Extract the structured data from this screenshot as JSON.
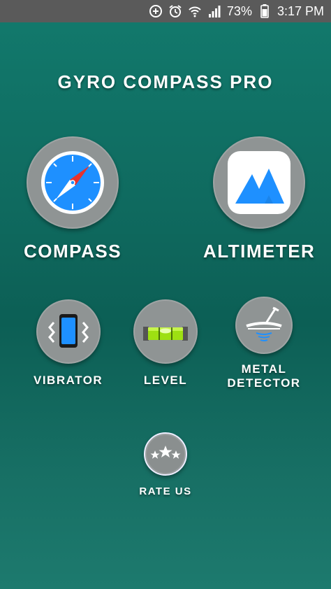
{
  "status_bar": {
    "battery_percent": "73%",
    "time": "3:17 PM",
    "icons": [
      "data-saver-icon",
      "alarm-icon",
      "wifi-icon",
      "signal-icon",
      "battery-icon"
    ]
  },
  "app": {
    "title": "GYRO COMPASS PRO"
  },
  "menu": {
    "compass": {
      "label": "COMPASS",
      "icon": "compass-icon"
    },
    "altimeter": {
      "label": "ALTIMETER",
      "icon": "mountain-icon"
    },
    "vibrator": {
      "label": "VIBRATOR",
      "icon": "vibrating-phone-icon"
    },
    "level": {
      "label": "LEVEL",
      "icon": "spirit-level-icon"
    },
    "metal_detector": {
      "label_line1": "METAL",
      "label_line2": "DETECTOR",
      "icon": "metal-detector-icon"
    },
    "rate_us": {
      "label": "RATE US",
      "icon": "stars-icon"
    }
  },
  "colors": {
    "background_top": "#127a6d",
    "background_mid": "#0c5f55",
    "status_bar": "#5a5a5a",
    "button_circle": "#8f9494",
    "accent_blue": "#1e90ff"
  }
}
